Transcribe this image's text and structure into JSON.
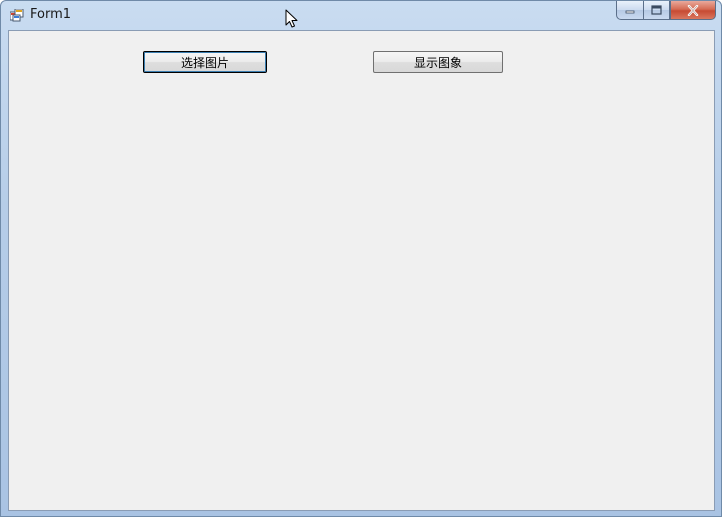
{
  "window": {
    "title": "Form1"
  },
  "buttons": {
    "select_image": "选择图片",
    "show_image": "显示图象"
  },
  "icons": {
    "app": "app-icon",
    "minimize": "minimize-icon",
    "maximize": "maximize-icon",
    "close": "close-icon",
    "cursor": "mouse-pointer-icon"
  },
  "colors": {
    "client_background": "#f0f0f0",
    "close_button": "#c74a33",
    "title_bar": "#b6cde8"
  }
}
